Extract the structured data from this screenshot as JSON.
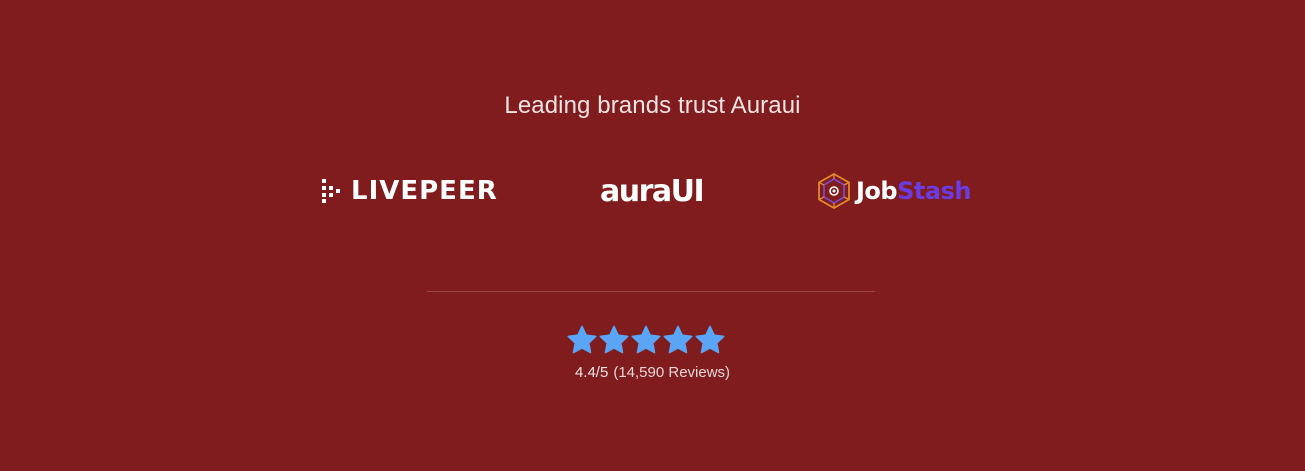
{
  "heading": "Leading brands trust Auraui",
  "logos": {
    "livepeer": {
      "name": "LIVEPEER",
      "icon": "livepeer-dots-icon"
    },
    "auraui": {
      "name": "auraUI"
    },
    "jobstash": {
      "name_part1": "Job",
      "name_part2": "Stash",
      "icon": "jobstash-cube-icon"
    }
  },
  "rating": {
    "stars": 5,
    "score": "4.4/5",
    "reviews": "(14,590 Reviews)"
  },
  "colors": {
    "background": "#801c1d",
    "star": "#5aa5f5",
    "jobstash_accent": "#6c3ce3",
    "jobstash_cube": "#e08a2c"
  }
}
